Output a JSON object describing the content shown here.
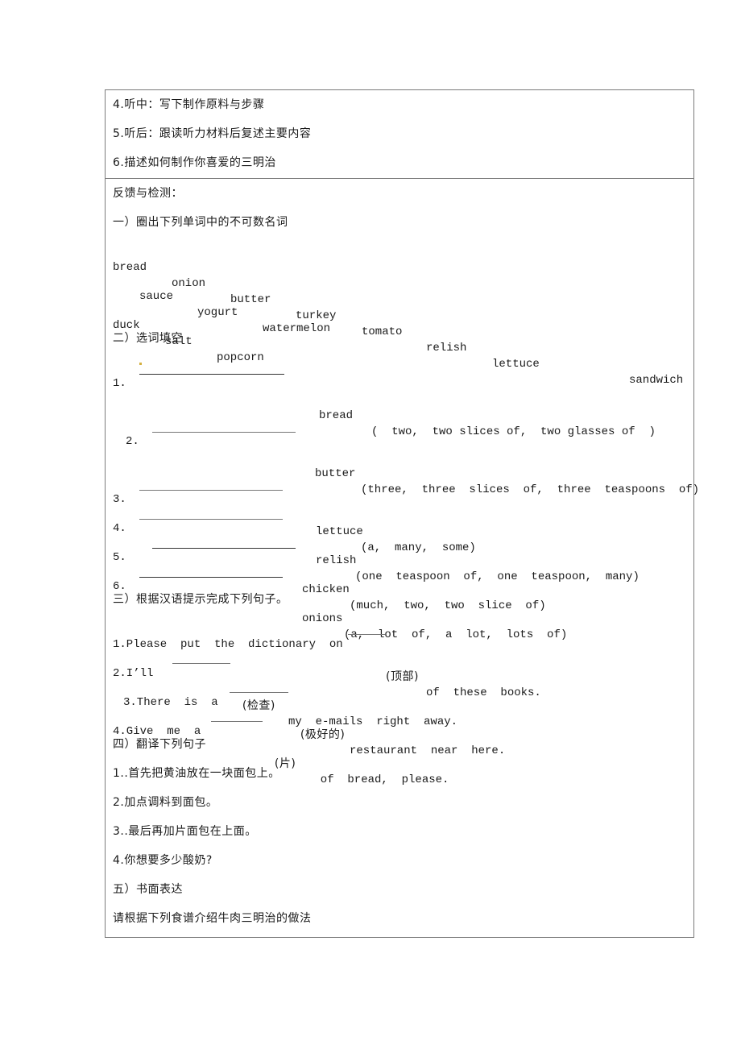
{
  "top_steps": [
    "4.听中：写下制作原料与步骤",
    "5.听后：跟读听力材料后复述主要内容",
    "6.描述如何制作你喜爱的三明治"
  ],
  "feedback_title": "反馈与检测：",
  "section1": {
    "title": "一）圈出下列单词中的不可数名词",
    "row1": [
      "bread",
      "onion",
      "butter",
      "turkey",
      "tomato",
      "relish",
      "lettuce",
      "sandwich"
    ],
    "row2": [
      "sauce",
      "yogurt",
      "watermelon"
    ],
    "row3": [
      "duck",
      "salt",
      "popcorn"
    ]
  },
  "section2": {
    "title": "二）选词填空",
    "items": [
      {
        "num": "1.",
        "word": "bread",
        "options": "(  two,  two slices of,  two glasses of  )"
      },
      {
        "num": "2.",
        "word": "butter",
        "options": "(three,  three  slices  of,  three  teaspoons  of)"
      },
      {
        "num": "3.",
        "word": "lettuce",
        "options": "(a,  many,  some)"
      },
      {
        "num": "4.",
        "word": "relish",
        "options": "(one  teaspoon  of,  one  teaspoon,  many)"
      },
      {
        "num": "5.",
        "word": "chicken",
        "options": "(much,  two,  two  slice  of)"
      },
      {
        "num": "6.",
        "word": "onions",
        "options": "(a,  lot  of,  a  lot,  lots  of)"
      }
    ]
  },
  "section3": {
    "title": "三）根据汉语提示完成下列句子。",
    "items": [
      {
        "pre": "1.Please  put  the  dictionary  on  ",
        "hint": "(顶部)",
        "post": "of  these  books."
      },
      {
        "pre": "2.I’ll  ",
        "hint": "  (检查)",
        "post": "my  e-mails  right  away."
      },
      {
        "pre": "3.There  is  a  ",
        "hint": "  (极好的)",
        "post": "restaurant  near  here."
      },
      {
        "pre": "4.Give  me  a  ",
        "hint": "  (片)",
        "post": "  of  bread,  please."
      }
    ]
  },
  "section4": {
    "title": "四）翻译下列句子",
    "items": [
      "1..首先把黄油放在一块面包上。",
      "2.加点调料到面包。",
      "3..最后再加片面包在上面。",
      "4.你想要多少酸奶?"
    ]
  },
  "section5": {
    "title": "五）书面表达",
    "prompt": "请根据下列食谱介绍牛肉三明治的做法"
  }
}
